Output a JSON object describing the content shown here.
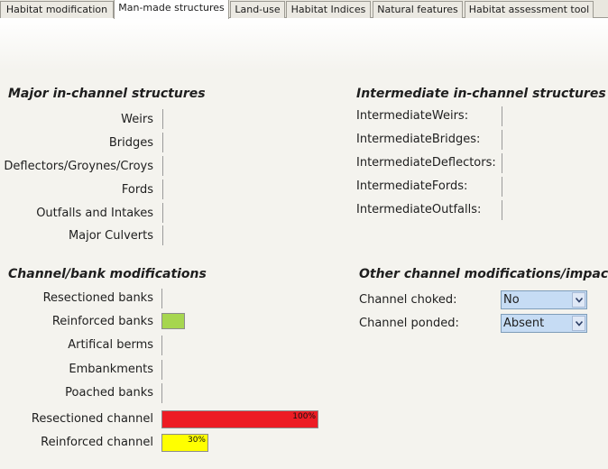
{
  "tabs": [
    {
      "label": "Habitat modification",
      "active": false
    },
    {
      "label": "Man-made structures",
      "active": true
    },
    {
      "label": "Land-use",
      "active": false
    },
    {
      "label": "Habitat Indices",
      "active": false
    },
    {
      "label": "Natural features",
      "active": false
    },
    {
      "label": "Habitat assessment tool",
      "active": false
    }
  ],
  "major": {
    "heading": "Major in-channel structures",
    "items": [
      "Weirs",
      "Bridges",
      "Deflectors/Groynes/Croys",
      "Fords",
      "Outfalls and Intakes",
      "Major Culverts"
    ]
  },
  "intermediate": {
    "heading": "Intermediate in-channel structures",
    "items": [
      "IntermediateWeirs:",
      "IntermediateBridges:",
      "IntermediateDeflectors:",
      "IntermediateFords:",
      "IntermediateOutfalls:"
    ]
  },
  "bank": {
    "heading": "Channel/bank modifications",
    "items": [
      {
        "label": "Resectioned banks",
        "bar_fraction": 0,
        "color": "",
        "pct_label": ""
      },
      {
        "label": "Reinforced banks",
        "bar_fraction": 0.15,
        "color": "#a6d64f",
        "pct_label": ""
      },
      {
        "label": "Artifical berms",
        "bar_fraction": 0,
        "color": "",
        "pct_label": ""
      },
      {
        "label": "Embankments",
        "bar_fraction": 0,
        "color": "",
        "pct_label": ""
      },
      {
        "label": "Poached banks",
        "bar_fraction": 0,
        "color": "",
        "pct_label": ""
      },
      {
        "label": "Resectioned channel",
        "bar_fraction": 1.0,
        "color": "#ed1c24",
        "pct_label": "100%"
      },
      {
        "label": "Reinforced channel",
        "bar_fraction": 0.3,
        "color": "#ffff00",
        "pct_label": "30%"
      }
    ]
  },
  "other": {
    "heading": "Other channel modifications/impacts",
    "choked_label": "Channel choked:",
    "choked_value": "No",
    "ponded_label": "Channel ponded:",
    "ponded_value": "Absent"
  },
  "colors": {
    "combo_bg": "#c6dcf4",
    "tab_active": "#fefefe"
  },
  "icons": {
    "dropdown": "chevron-down-icon"
  }
}
